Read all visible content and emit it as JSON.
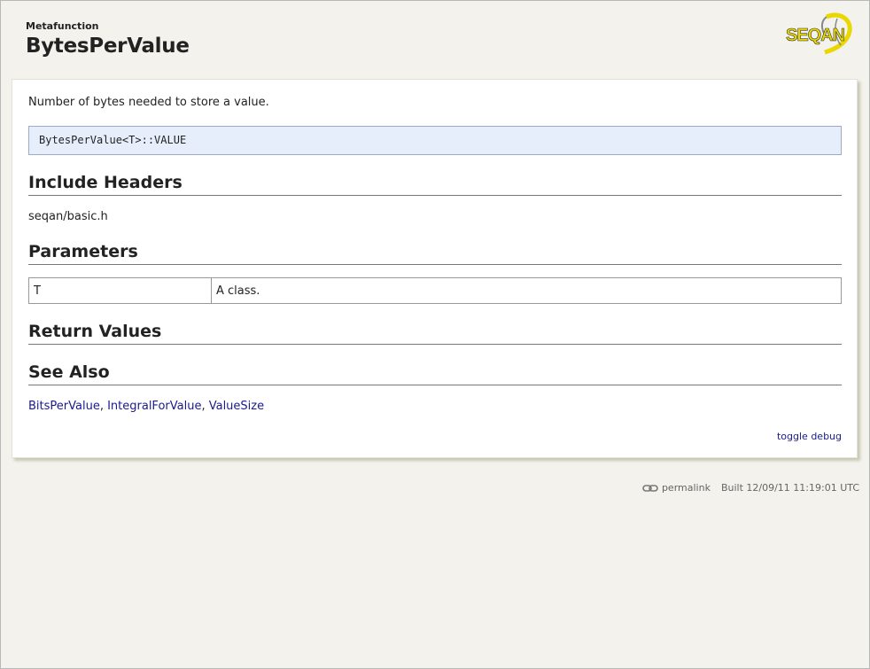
{
  "header": {
    "kind": "Metafunction",
    "title": "BytesPerValue",
    "logo_text": "SEQAN"
  },
  "summary": "Number of bytes needed to store a value.",
  "signature": "BytesPerValue<T>::VALUE",
  "sections": {
    "include_headers": "Include Headers",
    "parameters": "Parameters",
    "return_values": "Return Values",
    "see_also": "See Also"
  },
  "include_header_value": "seqan/basic.h",
  "parameters": [
    {
      "name": "T",
      "description": "A class."
    }
  ],
  "see_also_links": [
    "BitsPerValue",
    "IntegralForValue",
    "ValueSize"
  ],
  "see_also_separator": ", ",
  "toggle_debug_label": "toggle debug",
  "footer": {
    "permalink_label": "permalink",
    "built_label": "Built 12/09/11 11:19:01 UTC"
  },
  "colors": {
    "background": "#f3f2ec",
    "signature_bg": "#e7eefb",
    "link": "#1a1a8c",
    "logo_yellow": "#e8d800"
  },
  "icons": {
    "footer_link": "chain-link-icon",
    "logo": "seqan-logo"
  }
}
